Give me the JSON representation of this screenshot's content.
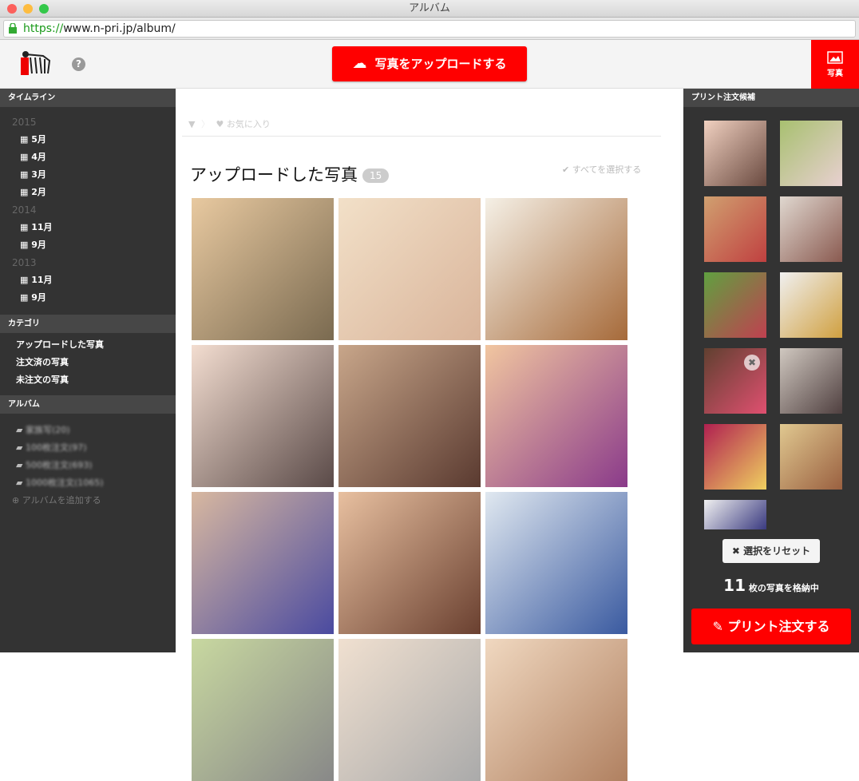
{
  "window": {
    "title": "アルバム"
  },
  "url": {
    "scheme": "https://",
    "rest": "www.n-pri.jp/album/"
  },
  "header": {
    "help": "?",
    "upload_label": "写真をアップロードする",
    "photo_tab": "写真"
  },
  "sidebar": {
    "timeline_title": "タイムライン",
    "timeline": [
      {
        "year": "2015",
        "months": [
          "5月",
          "4月",
          "3月",
          "2月"
        ]
      },
      {
        "year": "2014",
        "months": [
          "11月",
          "9月"
        ]
      },
      {
        "year": "2013",
        "months": [
          "11月",
          "9月"
        ]
      }
    ],
    "category_title": "カテゴリ",
    "categories": [
      "アップロードした写真",
      "注文済の写真",
      "未注文の写真"
    ],
    "album_title": "アルバム",
    "albums": [
      "家族写(20)",
      "100枚注文(97)",
      "500枚注文(693)",
      "1000枚注文(1065)"
    ],
    "add_album": "アルバムを追加する"
  },
  "main": {
    "favorites": "お気に入り",
    "title": "アップロードした写真",
    "count": "15",
    "select_all": "すべてを選択する"
  },
  "print": {
    "title": "プリント注文候補",
    "reset": "選択をリセット",
    "stored_count": "11",
    "stored_label": "枚の写真を格納中",
    "order": "プリント注文する"
  },
  "colors": {
    "accent": "#ff0000",
    "sidebar": "#333333"
  }
}
